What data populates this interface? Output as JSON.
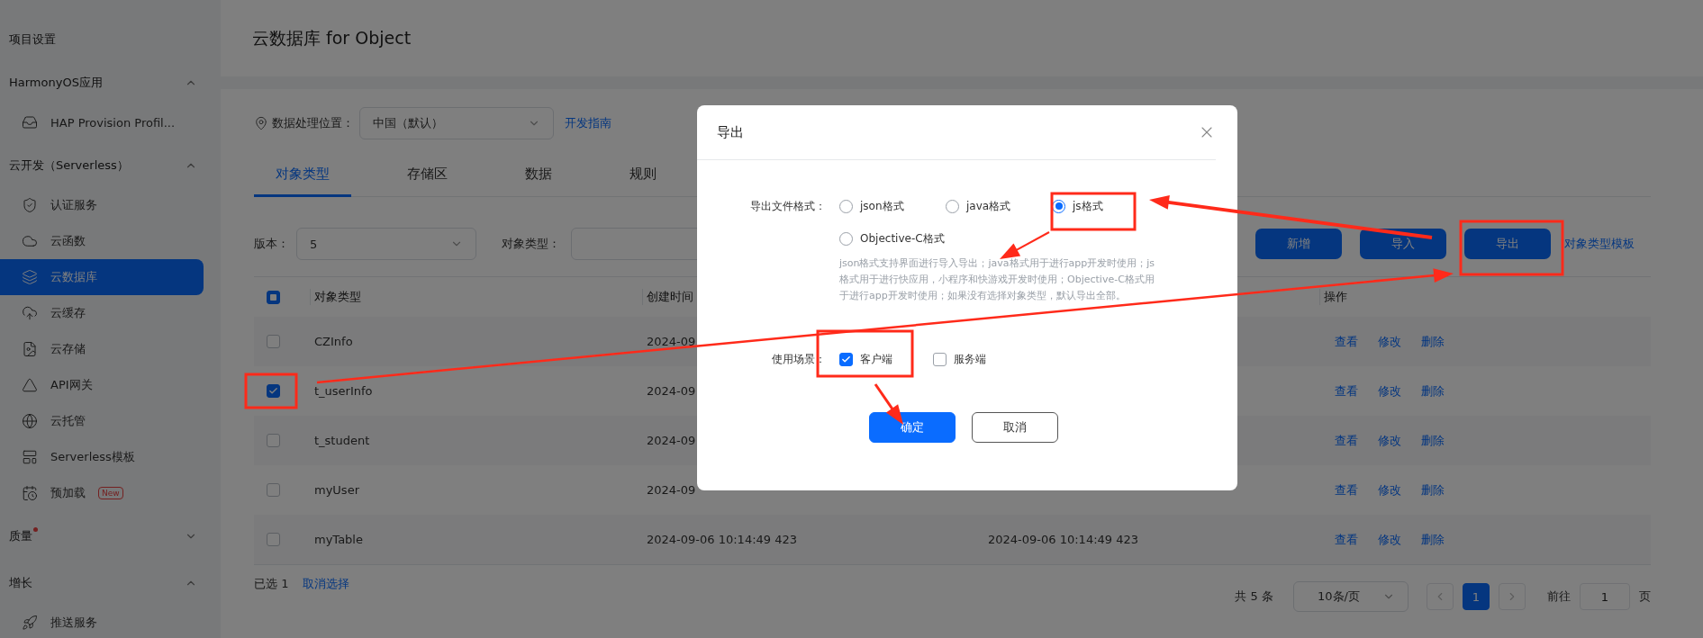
{
  "sidebar": {
    "sections": [
      {
        "title": "项目设置",
        "kind": "plain"
      },
      {
        "title": "HarmonyOS应用",
        "kind": "group",
        "expanded": true,
        "items": [
          {
            "label": "HAP Provision Profil...",
            "selected": false
          }
        ]
      },
      {
        "title": "云开发（Serverless）",
        "kind": "group",
        "expanded": true,
        "items": [
          {
            "label": "认证服务",
            "selected": false
          },
          {
            "label": "云函数",
            "selected": false
          },
          {
            "label": "云数据库",
            "selected": true
          },
          {
            "label": "云缓存",
            "selected": false
          },
          {
            "label": "云存储",
            "selected": false
          },
          {
            "label": "API网关",
            "selected": false
          },
          {
            "label": "云托管",
            "selected": false
          },
          {
            "label": "Serverless模板",
            "selected": false
          },
          {
            "label": "预加载",
            "selected": false,
            "badge": "New"
          }
        ]
      },
      {
        "title": "质量",
        "kind": "group",
        "expanded": false,
        "notice": true
      },
      {
        "title": "增长",
        "kind": "group",
        "expanded": true,
        "items": [
          {
            "label": "推送服务",
            "selected": false
          }
        ]
      }
    ]
  },
  "page_title": "云数据库 for Object",
  "location": {
    "label": "数据处理位置：",
    "value": "中国（默认）",
    "link": "开发指南"
  },
  "tabs": [
    {
      "label": "对象类型",
      "selected": true
    },
    {
      "label": "存储区",
      "selected": false
    },
    {
      "label": "数据",
      "selected": false
    },
    {
      "label": "规则",
      "selected": false
    }
  ],
  "filters": {
    "version_label": "版本：",
    "version": "5",
    "type_label": "对象类型："
  },
  "actions": [
    "新增",
    "导入",
    "导出"
  ],
  "template_link": "对象类型模板",
  "table": {
    "select_all": {
      "indeterminate": true
    },
    "header": {
      "name": "对象类型",
      "created": "创建时间",
      "actions": "操作"
    },
    "rows": [
      {
        "checked": false,
        "name": "CZInfo",
        "created": "2024-09",
        "actions": [
          "查看",
          "修改",
          "删除"
        ]
      },
      {
        "checked": true,
        "name": "t_userInfo",
        "created": "2024-09",
        "actions": [
          "查看",
          "修改",
          "删除"
        ]
      },
      {
        "checked": false,
        "name": "t_student",
        "created": "2024-09",
        "actions": [
          "查看",
          "修改",
          "删除"
        ]
      },
      {
        "checked": false,
        "name": "myUser",
        "created": "2024-09",
        "actions": [
          "查看",
          "修改",
          "删除"
        ]
      },
      {
        "checked": false,
        "name": "myTable",
        "created": "2024-09-06 10:14:49 423",
        "updated": "2024-09-06 10:14:49 423",
        "actions": [
          "查看",
          "修改",
          "删除"
        ]
      }
    ]
  },
  "footer": {
    "selected": "已选 1",
    "clear": "取消选择"
  },
  "pagination": {
    "total": "共 5 条",
    "page_size": "10条/页",
    "pages": [
      {
        "label": "1",
        "selected": true
      }
    ],
    "goto_label": "前往",
    "goto_value": "1",
    "page_suffix": "页"
  },
  "dialog": {
    "title": "导出",
    "format_label": "导出文件格式：",
    "formats": [
      {
        "label": "json格式",
        "selected": false
      },
      {
        "label": "java格式",
        "selected": false
      },
      {
        "label": "js格式",
        "selected": true
      },
      {
        "label": "Objective-C格式",
        "selected": false
      }
    ],
    "hint": "json格式支持界面进行导入导出；java格式用于进行app开发时使用；js格式用于进行快应用，小程序和快游戏开发时使用；Objective-C格式用于进行app开发时使用；如果没有选择对象类型，默认导出全部。",
    "usage_label": "使用场景：",
    "usages": [
      {
        "label": "客户端",
        "checked": true
      },
      {
        "label": "服务端",
        "checked": false
      }
    ],
    "buttons": [
      {
        "label": "确定",
        "kind": "primary"
      },
      {
        "label": "取消",
        "kind": "secondary"
      }
    ]
  }
}
